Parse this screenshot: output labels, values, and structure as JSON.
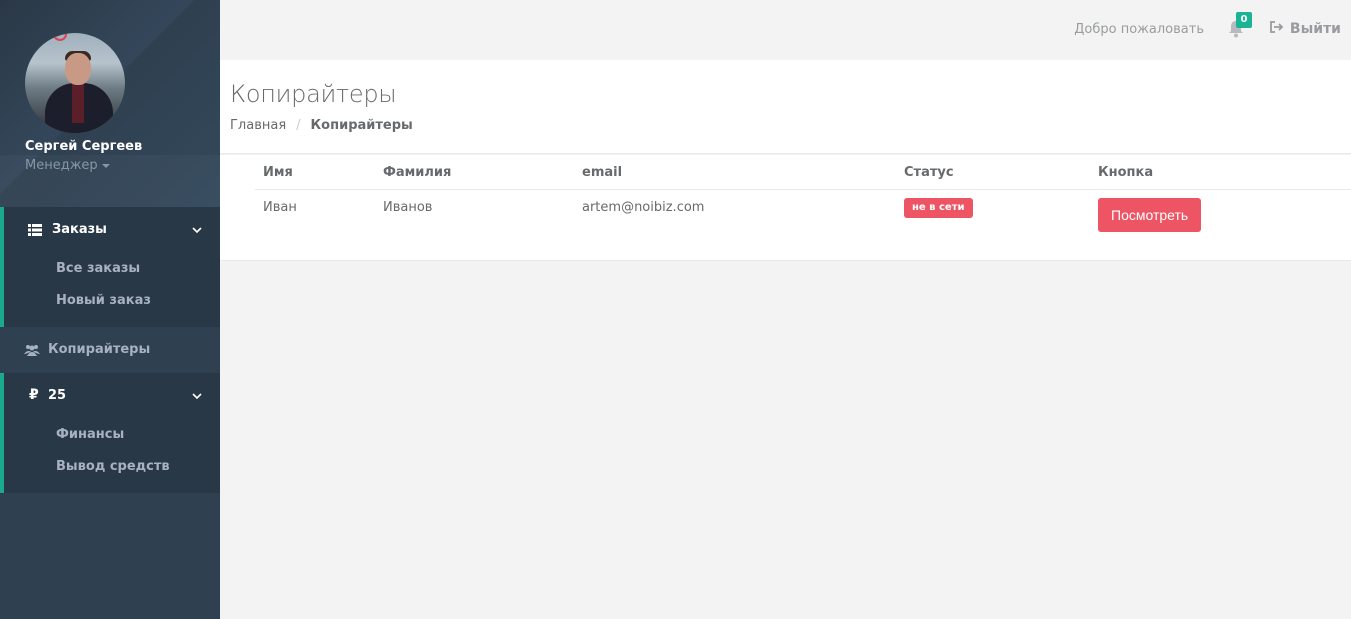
{
  "sidebar": {
    "profile": {
      "name": "Сергей Сергеев",
      "role": "Менеджер"
    },
    "groups": [
      {
        "label": "Заказы",
        "icon": "list-icon",
        "items": [
          "Все заказы",
          "Новый заказ"
        ]
      },
      {
        "label": "25",
        "icon": "ruble-icon",
        "items": [
          "Финансы",
          "Вывод средств"
        ]
      }
    ],
    "copywriters_label": "Копирайтеры"
  },
  "topbar": {
    "welcome": "Добро пожаловать",
    "notifications_count": "0",
    "logout_label": "Выйти"
  },
  "heading": {
    "title": "Копирайтеры",
    "breadcrumb": {
      "home": "Главная",
      "separator": "/",
      "active": "Копирайтеры"
    }
  },
  "table": {
    "columns": [
      "Имя",
      "Фамилия",
      "email",
      "Статус",
      "Кнопка"
    ],
    "rows": [
      {
        "first_name": "Иван",
        "last_name": "Иванов",
        "email": "artem@noibiz.com",
        "status": "не в сети",
        "button": "Посмотреть"
      }
    ]
  },
  "colors": {
    "sidebar": "#2f4050",
    "accent": "#19aa8d",
    "danger": "#ed5565",
    "badge": "#1ab394"
  }
}
